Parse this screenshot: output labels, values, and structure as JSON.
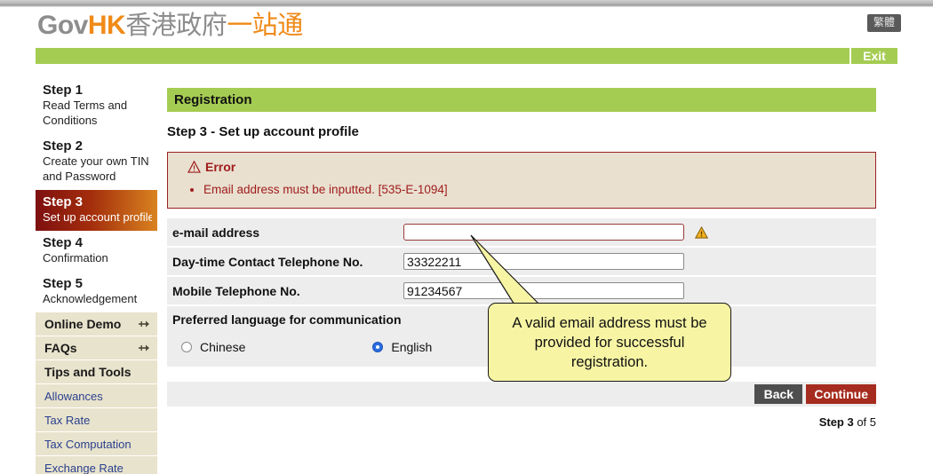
{
  "header": {
    "brand_gov": "Gov",
    "brand_hk": "HK",
    "brand_cn_grey": "香港政府",
    "brand_cn_orange": "一站通",
    "lang_toggle": "繁體",
    "exit_label": "Exit"
  },
  "sidebar": {
    "steps": [
      {
        "title": "Step 1",
        "desc": "Read Terms and Conditions",
        "active": false
      },
      {
        "title": "Step 2",
        "desc": "Create your own TIN and Password",
        "active": false
      },
      {
        "title": "Step 3",
        "desc": "Set up account profile",
        "active": true
      },
      {
        "title": "Step 4",
        "desc": "Confirmation",
        "active": false
      },
      {
        "title": "Step 5",
        "desc": "Acknowledgement",
        "active": false
      }
    ],
    "sections": [
      {
        "label": "Online Demo",
        "has_arrow": true
      },
      {
        "label": "FAQs",
        "has_arrow": true
      },
      {
        "label": "Tips and Tools",
        "has_arrow": false
      }
    ],
    "links": [
      "Allowances",
      "Tax Rate",
      "Tax Computation",
      "Exchange Rate"
    ]
  },
  "main": {
    "page_header": "Registration",
    "sub_header": "Step 3 - Set up account profile",
    "error": {
      "title": "Error",
      "items": [
        "Email address must be inputted.  [535-E-1094]"
      ]
    },
    "fields": [
      {
        "label": "e-mail address",
        "value": "",
        "error": true,
        "warning": true
      },
      {
        "label": "Day-time Contact Telephone No.",
        "value": "33322211",
        "error": false,
        "warning": false
      },
      {
        "label": "Mobile Telephone No.",
        "value": "91234567",
        "error": false,
        "warning": false
      }
    ],
    "language": {
      "title": "Preferred language for communication",
      "options": [
        {
          "label": "Chinese",
          "selected": false
        },
        {
          "label": "English",
          "selected": true
        }
      ]
    },
    "buttons": {
      "back": "Back",
      "continue": "Continue"
    },
    "step_counter": {
      "prefix": "Step 3",
      "suffix": " of 5"
    }
  },
  "callout": {
    "text": "A valid email address must be provided for successful registration."
  },
  "colors": {
    "green": "#a5cc52",
    "orange": "#f08a18",
    "error_red": "#a01c1c",
    "continue_red": "#a62c1f",
    "back_gray": "#4e4e4e",
    "sidebar_beige": "#e8e3cc",
    "link_blue": "#2a3f8f",
    "callout_yellow": "#f7f5a4"
  }
}
